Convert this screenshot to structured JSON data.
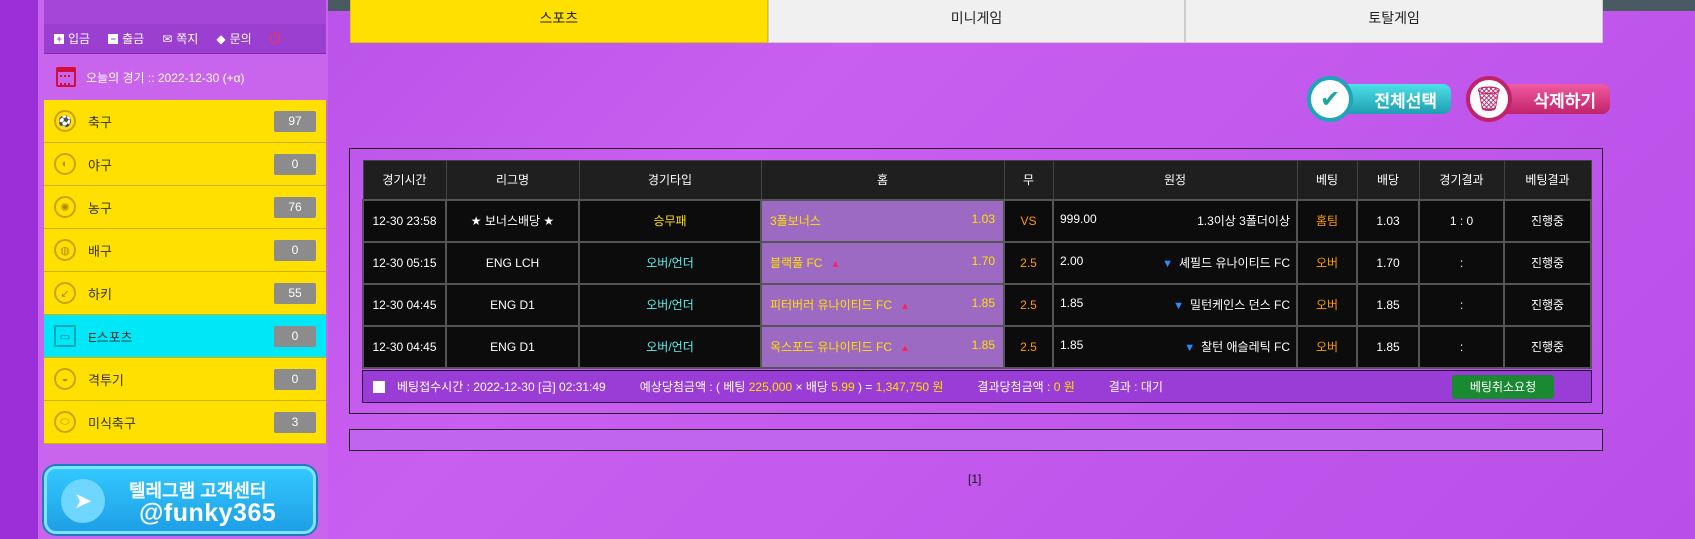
{
  "account_menu": {
    "deposit": "입금",
    "withdraw": "출금",
    "message": "쪽지",
    "inquiry": "문의"
  },
  "today_games": "오늘의 경기 :: 2022-12-30 (+α)",
  "sports": [
    {
      "name": "축구",
      "count": "97",
      "icon": "soccer-ball-icon"
    },
    {
      "name": "야구",
      "count": "0",
      "icon": "baseball-icon"
    },
    {
      "name": "농구",
      "count": "76",
      "icon": "basketball-icon"
    },
    {
      "name": "배구",
      "count": "0",
      "icon": "volleyball-icon"
    },
    {
      "name": "하키",
      "count": "55",
      "icon": "hockey-icon"
    },
    {
      "name": "E스포츠",
      "count": "0",
      "icon": "monitor-icon"
    },
    {
      "name": "격투기",
      "count": "0",
      "icon": "boxing-glove-icon"
    },
    {
      "name": "미식축구",
      "count": "3",
      "icon": "football-icon"
    }
  ],
  "telegram": {
    "title": "텔레그램 고객센터",
    "handle": "@funky365"
  },
  "tabs": [
    "스포츠",
    "미니게임",
    "토탈게임"
  ],
  "buttons": {
    "select_all": "전체선택",
    "delete": "삭제하기"
  },
  "table": {
    "headers": [
      "경기시간",
      "리그명",
      "경기타입",
      "홈",
      "무",
      "원정",
      "베팅",
      "배당",
      "경기결과",
      "베팅결과"
    ],
    "rows": [
      {
        "time": "12-30 23:58",
        "league": "★ 보너스배당 ★",
        "type": "승무패",
        "home": "3폴보너스",
        "home_odd": "1.03",
        "draw": "VS",
        "away_odd": "999.00",
        "away": "1.3이상 3폴더이상",
        "bet": "홈팀",
        "odds": "1.03",
        "result": "1 : 0",
        "status": "진행중"
      },
      {
        "time": "12-30 05:15",
        "league": "ENG LCH",
        "type": "오버/언더",
        "home": "블랙풀 FC",
        "home_odd": "1.70",
        "draw": "2.5",
        "away_odd": "2.00",
        "away": "셰필드 유나이티드 FC",
        "bet": "오버",
        "odds": "1.70",
        "result": ":",
        "status": "진행중"
      },
      {
        "time": "12-30 04:45",
        "league": "ENG D1",
        "type": "오버/언더",
        "home": "피터버러 유나이티드 FC",
        "home_odd": "1.85",
        "draw": "2.5",
        "away_odd": "1.85",
        "away": "밀턴케인스 던스 FC",
        "bet": "오버",
        "odds": "1.85",
        "result": ":",
        "status": "진행중"
      },
      {
        "time": "12-30 04:45",
        "league": "ENG D1",
        "type": "오버/언더",
        "home": "옥스포드 유나이티드 FC",
        "home_odd": "1.85",
        "draw": "2.5",
        "away_odd": "1.85",
        "away": "찰턴 애슬레틱 FC",
        "bet": "오버",
        "odds": "1.85",
        "result": ":",
        "status": "진행중"
      }
    ]
  },
  "slip": {
    "time_label": "베팅접수시간 :",
    "time": "2022-12-30 [금] 02:31:49",
    "expected_label": "예상당첨금액 : ( 베팅",
    "stake": "225,000",
    "times": "× 배당",
    "total_odds": "5.99",
    "equals": ") =",
    "expected": "1,347,750 원",
    "result_amount_label": "결과당첨금액 :",
    "result_amount": "0 원",
    "result_label": "결과 : 대기",
    "cancel": "베팅취소요청"
  },
  "pager": "[1]",
  "colors": {
    "accent_yellow": "#ffe000",
    "active_cyan": "#00e7f7",
    "bg_purple": "#c865ec"
  }
}
